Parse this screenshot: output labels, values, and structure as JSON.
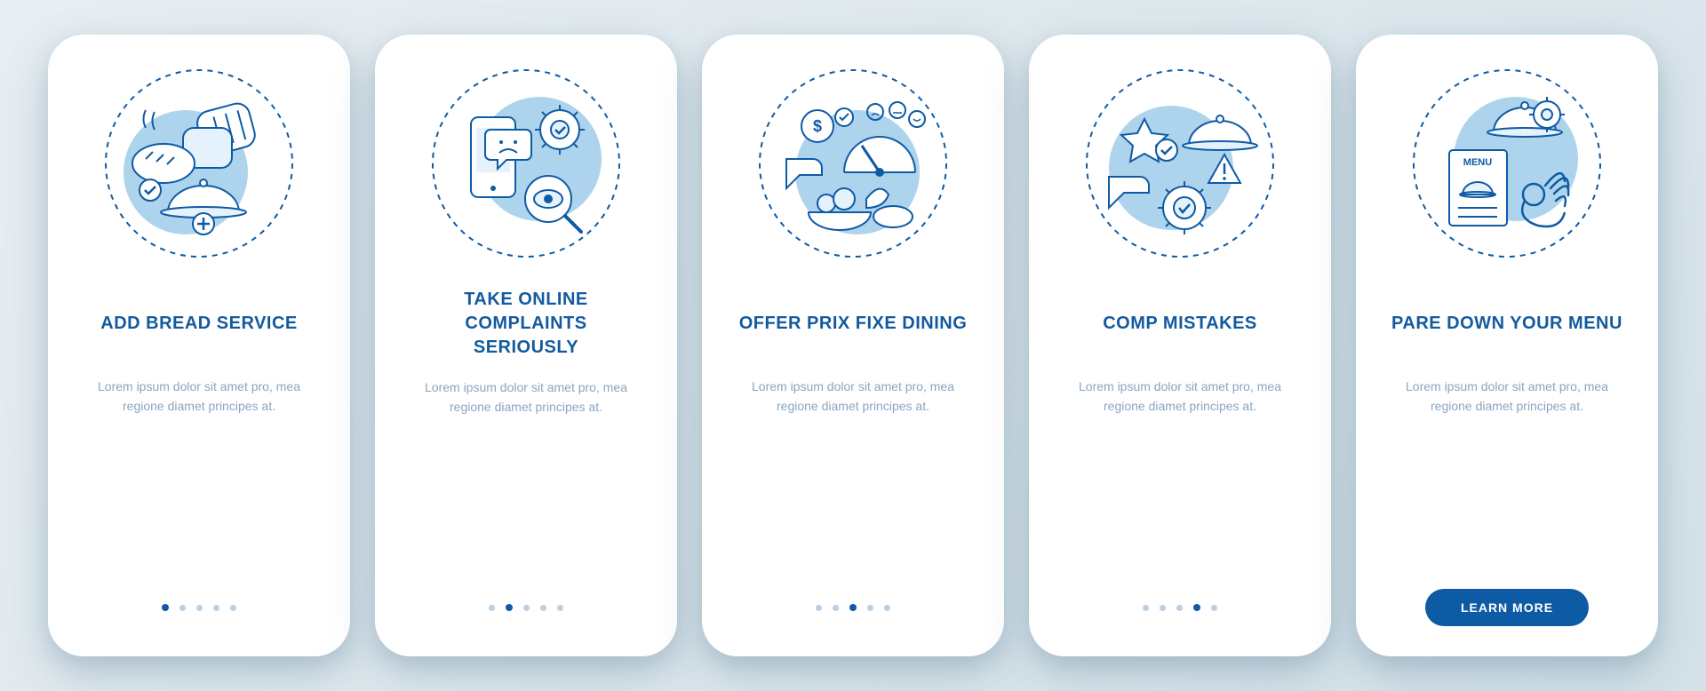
{
  "colors": {
    "primary": "#0e5ba5",
    "light": "#aed3ed"
  },
  "screens": [
    {
      "icon": "bread-service-icon",
      "title": "ADD BREAD SERVICE",
      "desc": "Lorem ipsum dolor sit amet pro, mea regione diamet principes at.",
      "activeDot": 0,
      "cta": null
    },
    {
      "icon": "online-complaints-icon",
      "title": "TAKE ONLINE COMPLAINTS SERIOUSLY",
      "desc": "Lorem ipsum dolor sit amet pro, mea regione diamet principes at.",
      "activeDot": 1,
      "cta": null
    },
    {
      "icon": "prix-fixe-icon",
      "title": "OFFER PRIX FIXE DINING",
      "desc": "Lorem ipsum dolor sit amet pro, mea regione diamet principes at.",
      "activeDot": 2,
      "cta": null
    },
    {
      "icon": "comp-mistakes-icon",
      "title": "COMP MISTAKES",
      "desc": "Lorem ipsum dolor sit amet pro, mea regione diamet principes at.",
      "activeDot": 3,
      "cta": null
    },
    {
      "icon": "pare-down-menu-icon",
      "title": "PARE DOWN YOUR MENU",
      "desc": "Lorem ipsum dolor sit amet pro, mea regione diamet principes at.",
      "activeDot": 4,
      "cta": "LEARN MORE"
    }
  ]
}
